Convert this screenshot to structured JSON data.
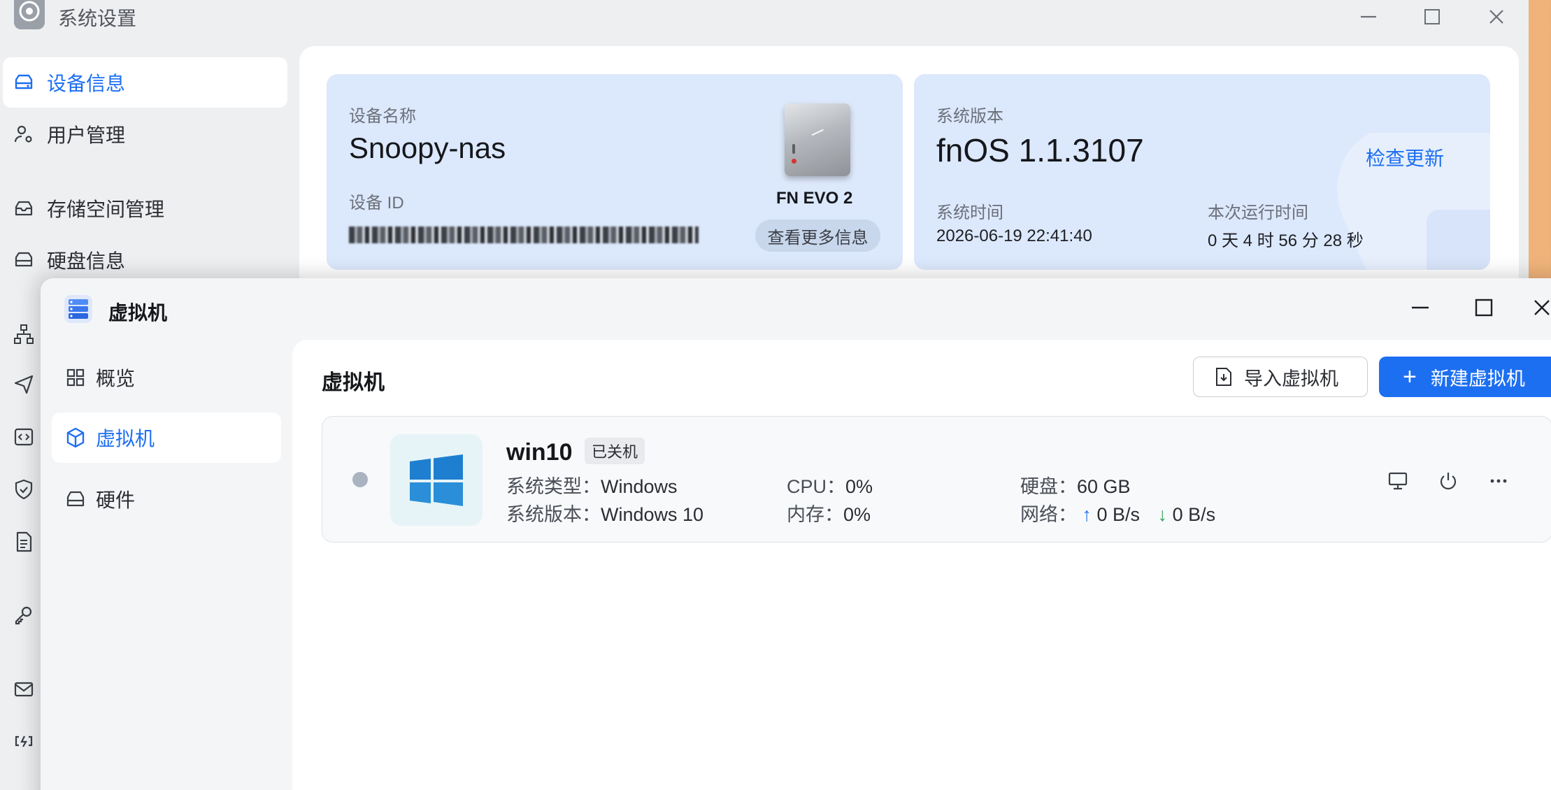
{
  "settings_window": {
    "title": "系统设置",
    "nav": {
      "device_info": "设备信息",
      "user_mgmt": "用户管理",
      "storage_mgmt": "存储空间管理",
      "disk_info": "硬盘信息"
    },
    "device_card": {
      "name_label": "设备名称",
      "name_value": "Snoopy-nas",
      "id_label": "设备 ID",
      "model": "FN EVO 2",
      "more_info_button": "查看更多信息"
    },
    "system_card": {
      "version_label": "系统版本",
      "version_value": "fnOS  1.1.3107",
      "check_update": "检查更新",
      "time_label": "系统时间",
      "time_value": "2026-06-19 22:41:40",
      "uptime_label": "本次运行时间",
      "uptime_value": "0 天 4 时 56 分 28 秒"
    }
  },
  "vm_window": {
    "title": "虚拟机",
    "nav": {
      "overview": "概览",
      "vms": "虚拟机",
      "hardware": "硬件"
    },
    "heading": "虚拟机",
    "import_button": "导入虚拟机",
    "new_button": "新建虚拟机",
    "new_button_icon": "+",
    "vm": {
      "name": "win10",
      "status": "已关机",
      "os_type_label": "系统类型：",
      "os_type": "Windows",
      "os_version_label": "系统版本：",
      "os_version": "Windows 10",
      "cpu_label": "CPU：",
      "cpu": "0%",
      "mem_label": "内存：",
      "mem": "0%",
      "disk_label": "硬盘：",
      "disk": "60 GB",
      "net_label": "网络：",
      "net_up": "0 B/s",
      "net_down": "0 B/s",
      "up_arrow": "↑",
      "down_arrow": "↓"
    }
  },
  "colors": {
    "accent": "#1d6ff2",
    "card_bg": "#dce8fb",
    "status_off": "#aab3c0",
    "net_down": "#3aa55b"
  }
}
